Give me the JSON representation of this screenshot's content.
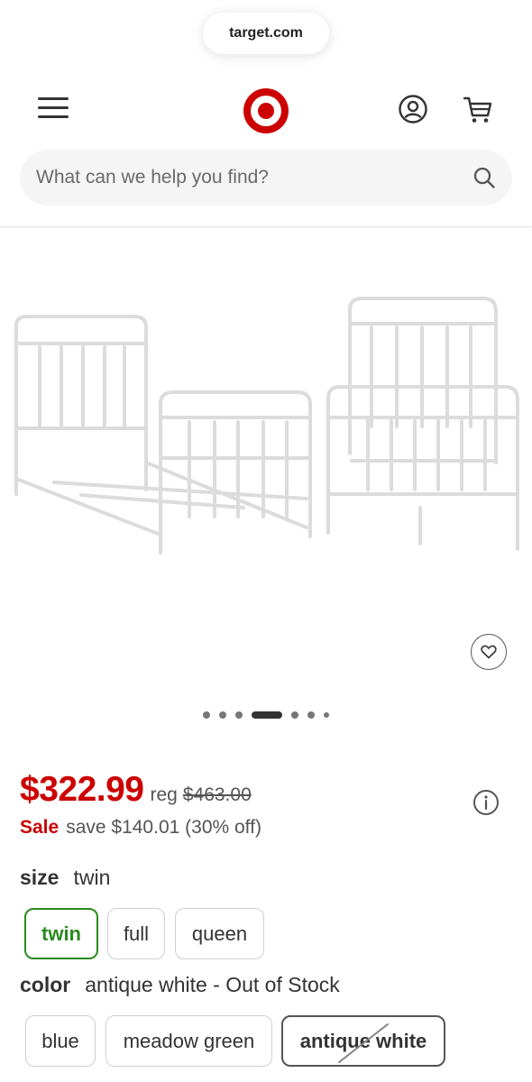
{
  "browser": {
    "url": "target.com"
  },
  "header": {
    "search_placeholder": "What can we help you find?",
    "brand_color": "#cc0000"
  },
  "gallery": {
    "dot_count": 7,
    "active_index": 3
  },
  "pricing": {
    "sale_price": "$322.99",
    "reg_label": "reg",
    "reg_price": "$463.00",
    "sale_label": "Sale",
    "save_text": "save $140.01 (30% off)"
  },
  "size": {
    "title": "size",
    "selected": "twin",
    "options": [
      "twin",
      "full",
      "queen"
    ]
  },
  "color": {
    "title": "color",
    "selected": "antique white - Out of Stock",
    "options": [
      "blue",
      "meadow green",
      "antique white"
    ]
  },
  "icons": {
    "menu": "hamburger-icon",
    "logo": "target-bullseye-logo",
    "account": "account-icon",
    "cart": "cart-icon",
    "search": "search-icon",
    "favorite": "heart-icon",
    "info": "info-icon"
  }
}
